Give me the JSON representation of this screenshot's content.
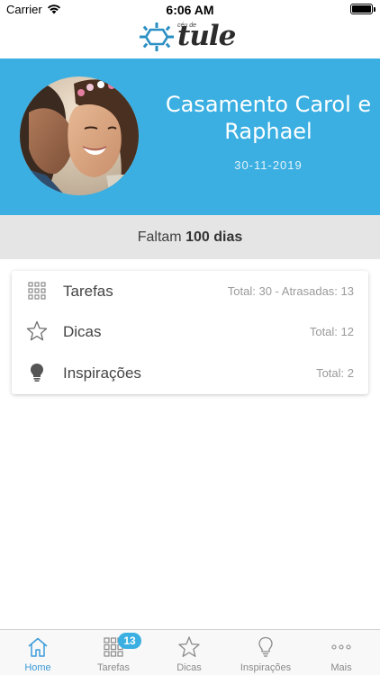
{
  "status_bar": {
    "carrier": "Carrier",
    "time": "6:06 AM"
  },
  "header": {
    "logo_small": "céu de",
    "logo_brand": "tule"
  },
  "hero": {
    "title": "Casamento Carol e Raphael",
    "date": "30-11-2019"
  },
  "countdown": {
    "prefix": "Faltam",
    "value": "100 dias"
  },
  "summary": {
    "items": [
      {
        "label": "Tarefas",
        "meta": "Total: 30 - Atrasadas: 13",
        "icon": "grid-icon"
      },
      {
        "label": "Dicas",
        "meta": "Total: 12",
        "icon": "star-icon"
      },
      {
        "label": "Inspirações",
        "meta": "Total: 2",
        "icon": "lightbulb-icon"
      }
    ]
  },
  "tabbar": {
    "tabs": [
      {
        "label": "Home",
        "icon": "home-icon",
        "active": true
      },
      {
        "label": "Tarefas",
        "icon": "grid-icon",
        "badge": "13"
      },
      {
        "label": "Dicas",
        "icon": "star-icon"
      },
      {
        "label": "Inspirações",
        "icon": "lightbulb-icon"
      },
      {
        "label": "Mais",
        "icon": "more-icon"
      }
    ]
  },
  "colors": {
    "accent": "#3bafe2",
    "tab_active": "#3b9ad9",
    "countdown_bg": "#e5e5e6"
  }
}
